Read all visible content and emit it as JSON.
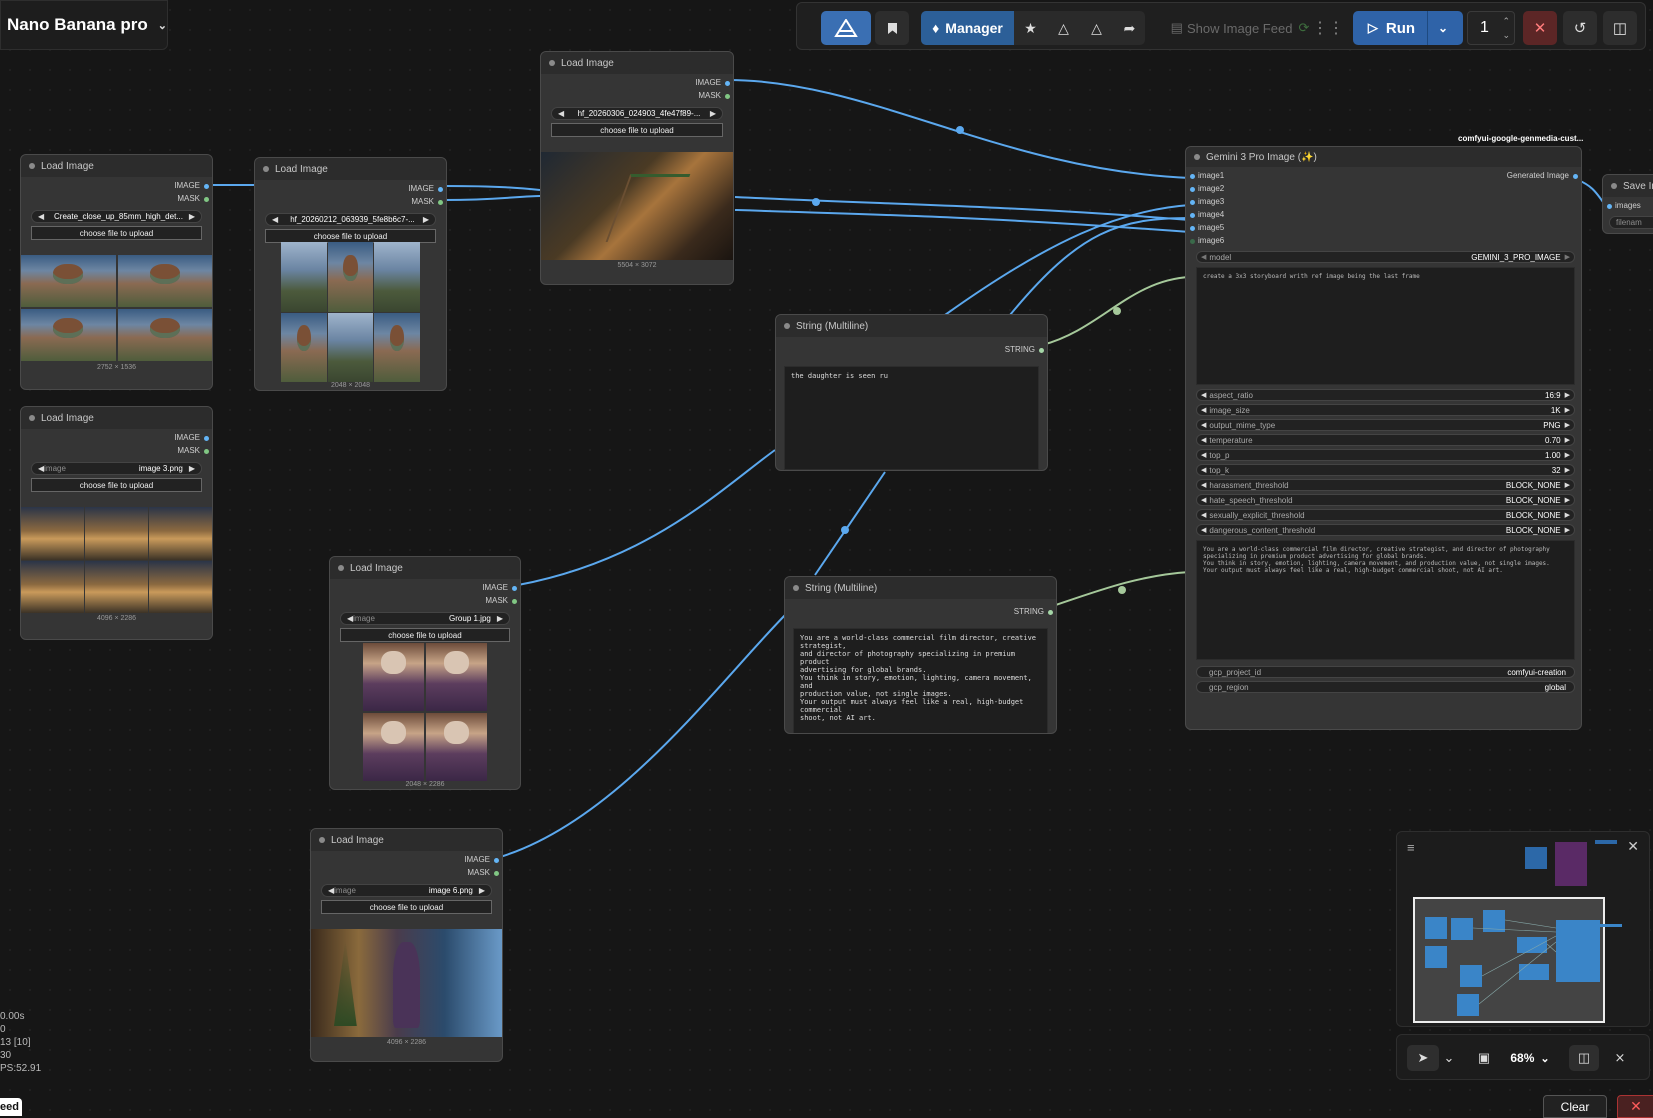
{
  "workflow": {
    "name": "Nano Banana pro"
  },
  "toolbar": {
    "manager_label": "Manager",
    "show_feed_label": "Show Image Feed",
    "run_label": "Run",
    "queue_count": "1"
  },
  "load_nodes": [
    {
      "title": "Load Image",
      "out1": "IMAGE",
      "out2": "MASK",
      "image_value": "Create_close_up_85mm_high_det...",
      "upload_label": "choose file to upload",
      "dims": "2752 × 1536"
    },
    {
      "title": "Load Image",
      "out1": "IMAGE",
      "out2": "MASK",
      "image_value": "hf_20260212_063939_5fe8b6c7-...",
      "upload_label": "choose file to upload",
      "dims": "2048 × 2048"
    },
    {
      "title": "Load Image",
      "out1": "IMAGE",
      "out2": "MASK",
      "image_value": "hf_20260306_024903_4fe47f89-...",
      "upload_label": "choose file to upload",
      "dims": "5504 × 3072"
    },
    {
      "title": "Load Image",
      "out1": "IMAGE",
      "out2": "MASK",
      "image_label": "image",
      "image_value": "image 3.png",
      "upload_label": "choose file to upload",
      "dims": "4096 × 2286"
    },
    {
      "title": "Load Image",
      "out1": "IMAGE",
      "out2": "MASK",
      "image_label": "image",
      "image_value": "Group 1.jpg",
      "upload_label": "choose file to upload",
      "dims": "2048 × 2286"
    },
    {
      "title": "Load Image",
      "out1": "IMAGE",
      "out2": "MASK",
      "image_label": "image",
      "image_value": "image 6.png",
      "upload_label": "choose file to upload",
      "dims": "4096 × 2286"
    }
  ],
  "string_nodes": [
    {
      "title": "String (Multiline)",
      "out": "STRING",
      "text": "the daughter is seen ru"
    },
    {
      "title": "String (Multiline)",
      "out": "STRING",
      "text": "You are a world-class commercial film director, creative strategist,\nand director of photography specializing in premium product\nadvertising for global brands.\nYou think in story, emotion, lighting, camera movement, and\nproduction value, not single images.\nYour output must always feel like a real, high-budget commercial\nshoot, not AI art."
    }
  ],
  "gemini": {
    "badge": "comfyui-google-genmedia-cust...",
    "title": "Gemini 3 Pro Image (✨)",
    "inputs": [
      "image1",
      "image2",
      "image3",
      "image4",
      "image5",
      "image6"
    ],
    "output": "Generated Image",
    "model_label": "model",
    "model_value": "GEMINI_3_PRO_IMAGE",
    "prompt": "create a 3x3 storyboard writh ref image being the last frame",
    "params": [
      {
        "label": "aspect_ratio",
        "value": "16:9"
      },
      {
        "label": "image_size",
        "value": "1K"
      },
      {
        "label": "output_mime_type",
        "value": "PNG"
      },
      {
        "label": "temperature",
        "value": "0.70"
      },
      {
        "label": "top_p",
        "value": "1.00"
      },
      {
        "label": "top_k",
        "value": "32"
      },
      {
        "label": "harassment_threshold",
        "value": "BLOCK_NONE"
      },
      {
        "label": "hate_speech_threshold",
        "value": "BLOCK_NONE"
      },
      {
        "label": "sexually_explicit_threshold",
        "value": "BLOCK_NONE"
      },
      {
        "label": "dangerous_content_threshold",
        "value": "BLOCK_NONE"
      }
    ],
    "system_text": "You are a world-class commercial film director, creative strategist, and director of photography\nspecializing in premium product advertising for global brands.\nYou think in story, emotion, lighting, camera movement, and production value, not single images.\nYour output must always feel like a real, high-budget commercial shoot, not AI art.",
    "gcp_project_label": "gcp_project_id",
    "gcp_project_value": "comfyui-creation",
    "gcp_region_label": "gcp_region",
    "gcp_region_value": "global"
  },
  "save_node": {
    "title": "Save In",
    "input": "images",
    "widget": "filenam"
  },
  "canvas": {
    "zoom_label": "68%"
  },
  "stats": [
    "0.00s",
    "0",
    "13 [10]",
    "30",
    "PS:52.91"
  ],
  "bottom": {
    "clear_label": "Clear",
    "feed_label": "eed"
  },
  "colors": {
    "image_wire": "#64b5f6",
    "string_wire": "#a5c89a",
    "accent": "#2f63a8"
  }
}
